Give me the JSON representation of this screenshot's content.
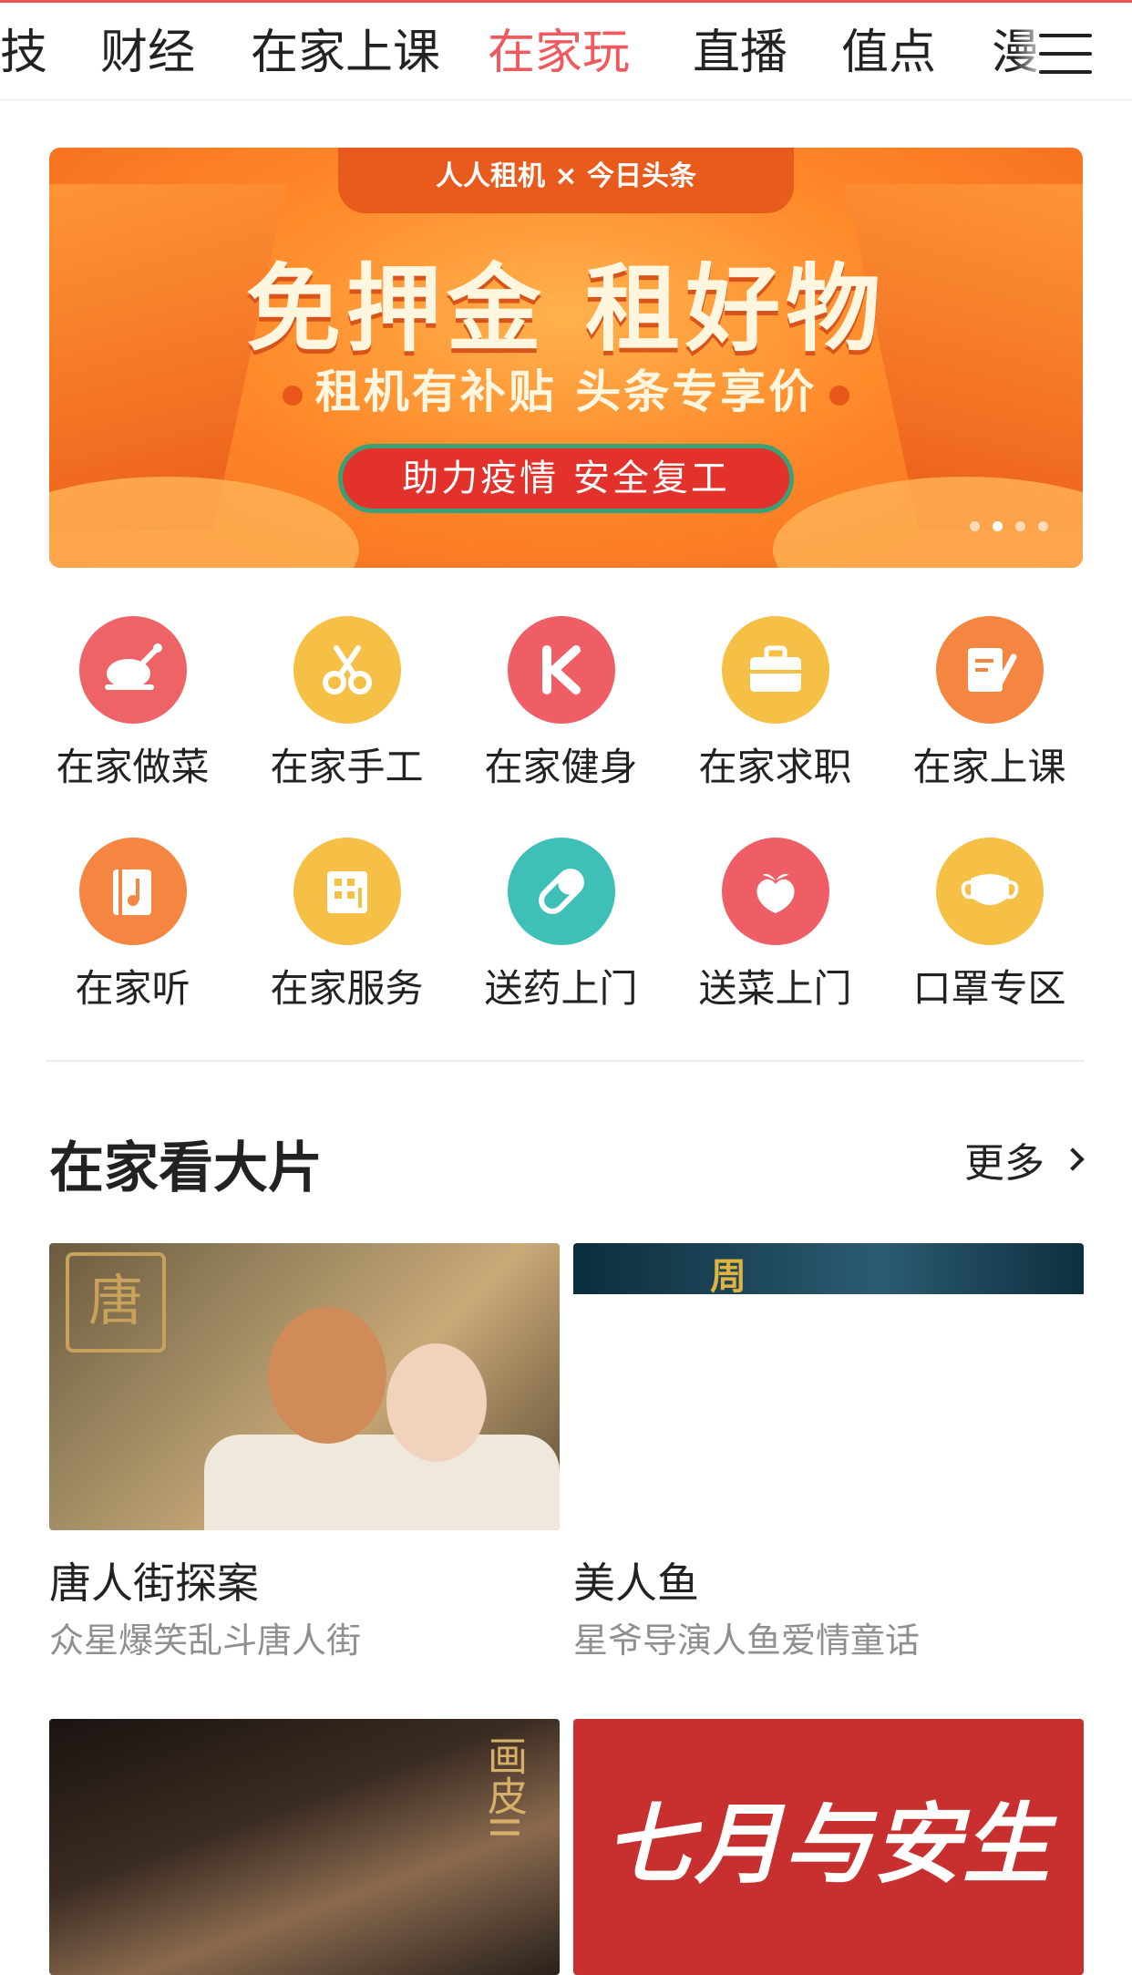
{
  "tabs": [
    {
      "label": "技",
      "active": false
    },
    {
      "label": "财经",
      "active": false
    },
    {
      "label": "在家上课",
      "active": false
    },
    {
      "label": "在家玩",
      "active": true
    },
    {
      "label": "直播",
      "active": false
    },
    {
      "label": "值点",
      "active": false
    },
    {
      "label": "漫",
      "active": false
    }
  ],
  "banner": {
    "brand": "人人租机 × 今日头条",
    "headline": "免押金 租好物",
    "subline": "租机有补贴 头条专享价",
    "pill": "助力疫情 安全复工",
    "dots_total": 4,
    "dots_active_index": 1
  },
  "categories": [
    {
      "label": "在家做菜",
      "icon": "chicken-icon",
      "color": "#ed6366"
    },
    {
      "label": "在家手工",
      "icon": "scissors-icon",
      "color": "#f6bf45"
    },
    {
      "label": "在家健身",
      "icon": "keep-k-icon",
      "color": "#ef5d65"
    },
    {
      "label": "在家求职",
      "icon": "briefcase-icon",
      "color": "#f6bf45"
    },
    {
      "label": "在家上课",
      "icon": "notebook-pen-icon",
      "color": "#f48641"
    },
    {
      "label": "在家听",
      "icon": "music-note-icon",
      "color": "#f48641"
    },
    {
      "label": "在家服务",
      "icon": "building-icon",
      "color": "#f6bf45"
    },
    {
      "label": "送药上门",
      "icon": "pill-icon",
      "color": "#3fc0b6"
    },
    {
      "label": "送菜上门",
      "icon": "peach-icon",
      "color": "#ef5d65"
    },
    {
      "label": "口罩专区",
      "icon": "mask-icon",
      "color": "#f6bf45"
    }
  ],
  "section": {
    "title": "在家看大片",
    "more": "更多"
  },
  "movies": [
    {
      "title": "唐人街探案",
      "subtitle": "众星爆笑乱斗唐人街"
    },
    {
      "title": "美人鱼",
      "subtitle": "星爷导演人鱼爱情童话"
    },
    {
      "title": "",
      "subtitle": "",
      "poster_text": "画皮II"
    },
    {
      "title": "",
      "subtitle": "",
      "poster_text": "七月与安生"
    }
  ]
}
